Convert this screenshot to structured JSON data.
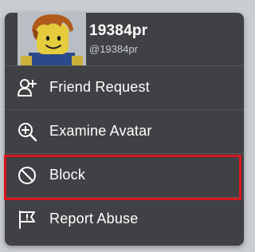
{
  "profile": {
    "display_name": "19384pr",
    "username": "@19384pr"
  },
  "menu": {
    "items": [
      {
        "label": "Friend Request",
        "icon": "add-friend-icon"
      },
      {
        "label": "Examine Avatar",
        "icon": "zoom-in-icon"
      },
      {
        "label": "Block",
        "icon": "block-icon"
      },
      {
        "label": "Report Abuse",
        "icon": "flag-icon"
      }
    ]
  },
  "colors": {
    "menu_background": "#3f4144",
    "divider": "#54575b",
    "text": "#ffffff",
    "highlight": "#d8161c"
  }
}
